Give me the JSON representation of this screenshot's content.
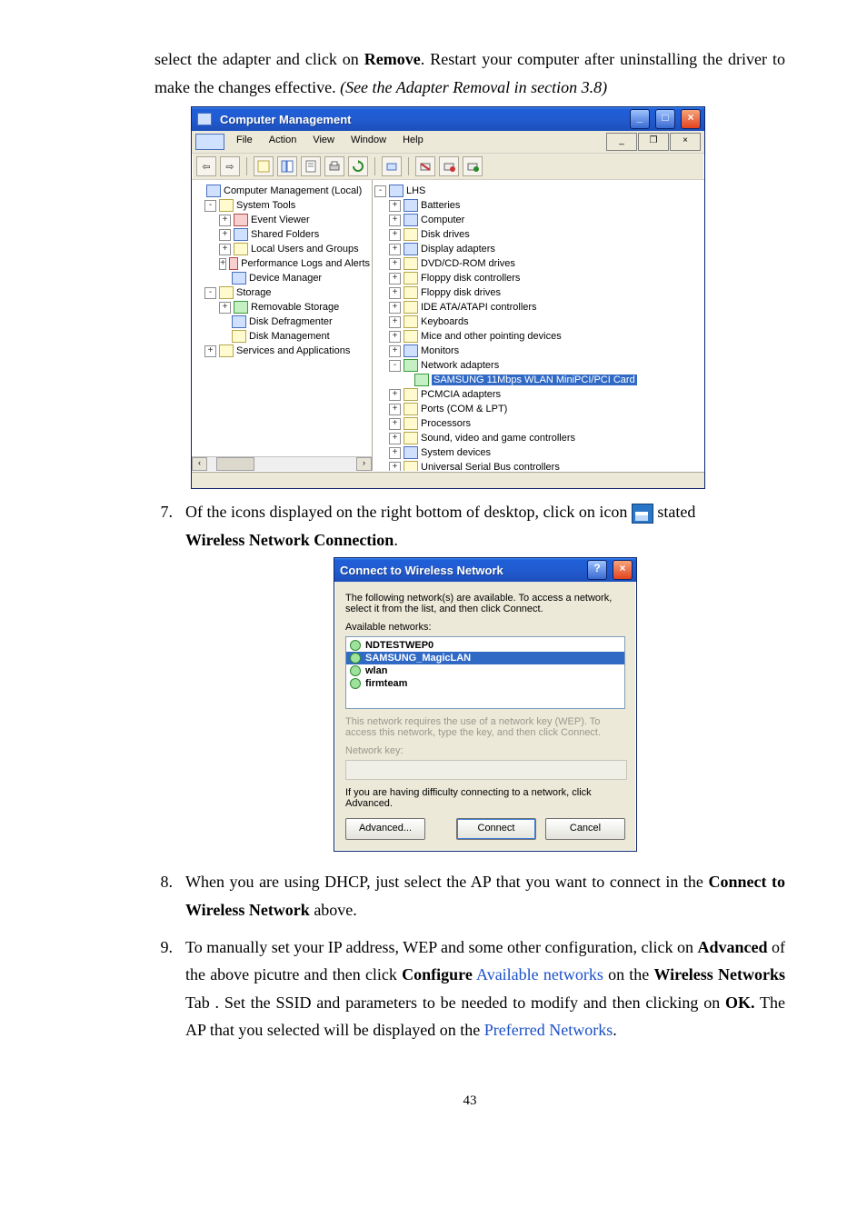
{
  "intro": {
    "line1_pre": "select the adapter and click on ",
    "line1_bold": "Remove",
    "line1_post": ". Restart your computer after uninstalling",
    "line2_pre": "the driver to make the changes effective. ",
    "line2_italic": "(See the Adapter Removal in section 3.8)"
  },
  "cm": {
    "title": "Computer Management",
    "menus": [
      "File",
      "Action",
      "View",
      "Window",
      "Help"
    ],
    "left_tree": {
      "root": "Computer Management (Local)",
      "system_tools": "System Tools",
      "event_viewer": "Event Viewer",
      "shared_folders": "Shared Folders",
      "local_users": "Local Users and Groups",
      "perf_logs": "Performance Logs and Alerts",
      "device_manager": "Device Manager",
      "storage": "Storage",
      "removable": "Removable Storage",
      "defrag": "Disk Defragmenter",
      "diskmgmt": "Disk Management",
      "services": "Services and Applications"
    },
    "right_tree": {
      "root": "LHS",
      "batteries": "Batteries",
      "computer": "Computer",
      "disk_drives": "Disk drives",
      "display": "Display adapters",
      "dvd": "DVD/CD-ROM drives",
      "floppy_ctrl": "Floppy disk controllers",
      "floppy_drv": "Floppy disk drives",
      "ide": "IDE ATA/ATAPI controllers",
      "keyboards": "Keyboards",
      "mice": "Mice and other pointing devices",
      "monitors": "Monitors",
      "net_adapters": "Network adapters",
      "selected_card": "SAMSUNG 11Mbps WLAN MiniPCI/PCI Card",
      "pcmcia": "PCMCIA adapters",
      "ports": "Ports (COM & LPT)",
      "processors": "Processors",
      "svg_ctrl": "Sound, video and game controllers",
      "sys_dev": "System devices",
      "usb": "Universal Serial Bus controllers"
    }
  },
  "step7": {
    "num": "7.",
    "pre": "Of the icons displayed on the right bottom of desktop, click on icon ",
    "post_pre": " stated ",
    "bold": "Wireless Network Connection",
    "period": "."
  },
  "dlg": {
    "title": "Connect to Wireless Network",
    "desc": "The following network(s) are available. To access a network, select it from the list, and then click Connect.",
    "avail_label": "Available networks:",
    "items": [
      "NDTESTWEP0",
      "SAMSUNG_MagicLAN",
      "wlan",
      "firmteam"
    ],
    "wep_text": "This network requires the use of a network key (WEP). To access this network, type the key, and then click Connect.",
    "key_label": "Network key:",
    "diff_text": "If you are having difficulty connecting to a network, click Advanced.",
    "btn_advanced": "Advanced...",
    "btn_connect": "Connect",
    "btn_cancel": "Cancel"
  },
  "step8": {
    "num": "8.",
    "pre": "When you are using DHCP, just select the AP that you want to connect in the ",
    "bold": "Connect to Wireless Network",
    "post": " above."
  },
  "step9": {
    "num": "9.",
    "s1": "To manually set your IP address, WEP and some other configuration, click on ",
    "b1": "Advanced",
    "s2": " of the above picutre and then click ",
    "b2": "Configure",
    "s3": " ",
    "link1": "Available networks",
    "s4": " on the ",
    "b3": "Wireless Networks",
    "s5": " Tab . Set the SSID and parameters to be needed to modify and then clicking on ",
    "b4": "OK.",
    "s6": " The AP that you selected will be displayed on the ",
    "link2": "Preferred Networks",
    "s7": "."
  },
  "page_number": "43"
}
